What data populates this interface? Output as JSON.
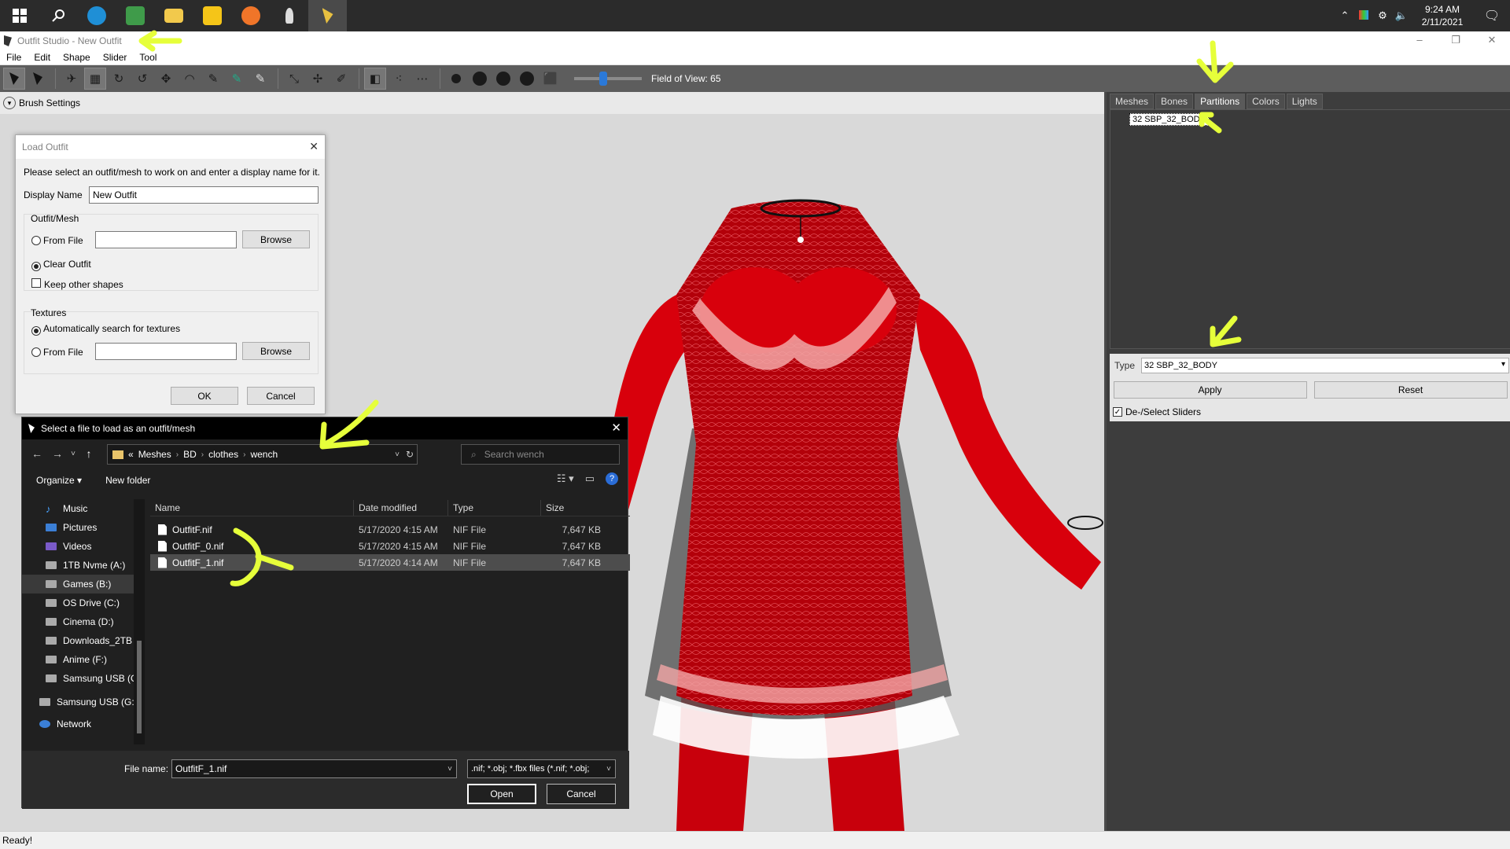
{
  "taskbar": {
    "start_icon": "windows-logo-icon",
    "search_icon": "search-icon",
    "apps": [
      {
        "name": "edge",
        "color": "#1f8fd6"
      },
      {
        "name": "spreadsheet",
        "color": "#3f9b4a"
      },
      {
        "name": "file-explorer",
        "color": "#f2c94c"
      },
      {
        "name": "plex",
        "color": "#f5c518"
      },
      {
        "name": "firefox",
        "color": "#f07529"
      },
      {
        "name": "feather-app",
        "color": "#dddddd"
      },
      {
        "name": "outfit-studio",
        "color": "#e8c040"
      }
    ],
    "time": "9:24 AM",
    "date": "2/11/2021"
  },
  "window": {
    "title": "Outfit Studio - New Outfit",
    "controls": [
      "–",
      "❐",
      "✕"
    ]
  },
  "menu": [
    "File",
    "Edit",
    "Shape",
    "Slider",
    "Tool"
  ],
  "toolbar": {
    "fov_label": "Field of View: 65",
    "fov_value": 65
  },
  "brush": {
    "label": "Brush Settings"
  },
  "right_panel": {
    "tabs": [
      "Meshes",
      "Bones",
      "Partitions",
      "Colors",
      "Lights"
    ],
    "active_tab": "Partitions",
    "partitions": [
      "32 SBP_32_BODY"
    ],
    "type_label": "Type",
    "type_value": "32 SBP_32_BODY",
    "apply_label": "Apply",
    "reset_label": "Reset",
    "deselect_label": "De-/Select Sliders"
  },
  "load_dialog": {
    "title": "Load Outfit",
    "instructions": "Please select an outfit/mesh to work on and enter a display name for it.",
    "display_name_label": "Display Name",
    "display_name_value": "New Outfit",
    "mesh_group": "Outfit/Mesh",
    "from_file": "From File",
    "browse": "Browse",
    "clear_outfit": "Clear Outfit",
    "keep_shapes": "Keep other shapes",
    "textures_group": "Textures",
    "auto_search": "Automatically search for textures",
    "ok": "OK",
    "cancel": "Cancel"
  },
  "file_dialog": {
    "title": "Select a file to load as an outfit/mesh",
    "path": [
      "Meshes",
      "BD",
      "clothes",
      "wench"
    ],
    "path_prefix": "«",
    "search_placeholder": "Search wench",
    "organize": "Organize ▾",
    "new_folder": "New folder",
    "nav_items": [
      {
        "label": "Music",
        "icon": "music-icon"
      },
      {
        "label": "Pictures",
        "icon": "pictures-icon"
      },
      {
        "label": "Videos",
        "icon": "videos-icon"
      },
      {
        "label": "1TB Nvme (A:)",
        "icon": "drive-icon"
      },
      {
        "label": "Games (B:)",
        "icon": "drive-icon"
      },
      {
        "label": "OS Drive (C:)",
        "icon": "drive-icon"
      },
      {
        "label": "Cinema (D:)",
        "icon": "drive-icon"
      },
      {
        "label": "Downloads_2TB",
        "icon": "drive-icon"
      },
      {
        "label": "Anime (F:)",
        "icon": "drive-icon"
      },
      {
        "label": "Samsung USB (G",
        "icon": "drive-icon"
      },
      {
        "label": "Samsung USB (G:)",
        "icon": "usb-icon"
      },
      {
        "label": "Network",
        "icon": "network-icon"
      }
    ],
    "columns": [
      "Name",
      "Date modified",
      "Type",
      "Size"
    ],
    "files": [
      {
        "name": "OutfitF.nif",
        "date": "5/17/2020 4:15 AM",
        "type": "NIF File",
        "size": "7,647 KB"
      },
      {
        "name": "OutfitF_0.nif",
        "date": "5/17/2020 4:15 AM",
        "type": "NIF File",
        "size": "7,647 KB"
      },
      {
        "name": "OutfitF_1.nif",
        "date": "5/17/2020 4:14 AM",
        "type": "NIF File",
        "size": "7,647 KB"
      }
    ],
    "filename_label": "File name:",
    "filename_value": "OutfitF_1.nif",
    "filetype_value": ".nif; *.obj; *.fbx files (*.nif; *.obj;",
    "open": "Open",
    "cancel": "Cancel"
  },
  "status": "Ready!",
  "colors": {
    "outfit_red": "#d8000c",
    "lace_pink": "#f3a6a6",
    "annotation": "#e6ff3a",
    "panel_dark": "#3d3d3d"
  }
}
